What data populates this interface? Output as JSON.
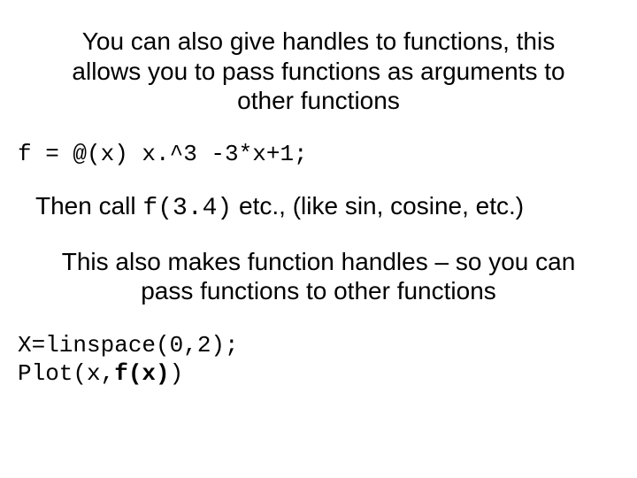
{
  "intro": "You can also give handles to functions, this allows you to pass functions as arguments to other functions",
  "code1": "f = @(x) x.^3 -3*x+1;",
  "then_prefix": "Then call ",
  "then_code": "f(3.4)",
  "then_suffix": " etc., (like sin, cosine, etc.)",
  "explain": "This also makes function handles – so you can pass functions to other functions",
  "code2_line1": "X=linspace(0,2);",
  "code2_line2a": "Plot(x,",
  "code2_line2b": "f(x)",
  "code2_line2c": ")"
}
